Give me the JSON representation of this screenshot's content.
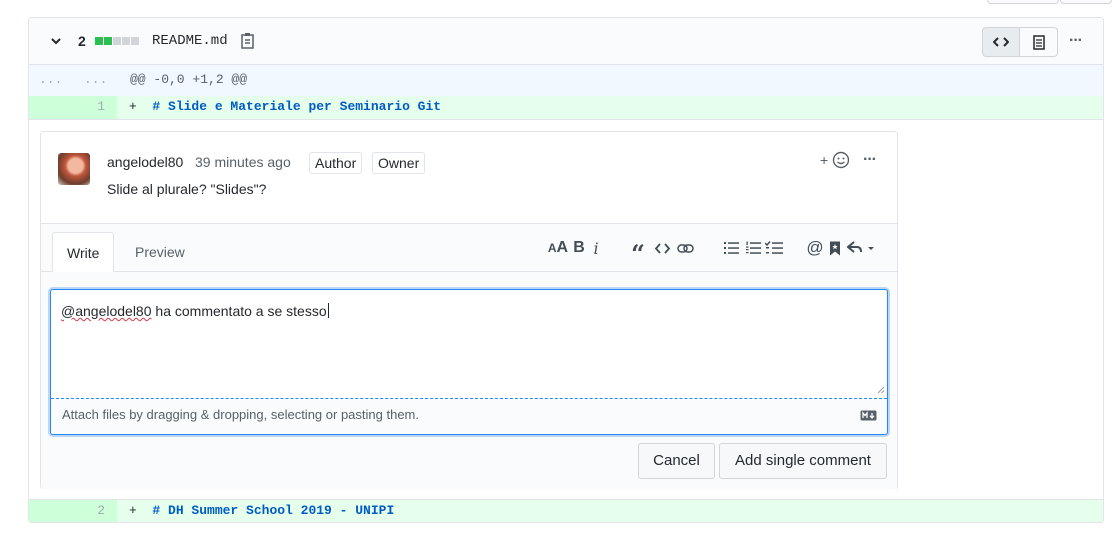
{
  "file": {
    "change_count": "2",
    "filename": "README.md",
    "diffstat_colors": [
      "#2cbe4e",
      "#2cbe4e",
      "#d1d5da",
      "#d1d5da",
      "#d1d5da"
    ]
  },
  "hunk": {
    "old_marker": "...",
    "new_marker": "...",
    "header": "@@ -0,0 +1,2 @@"
  },
  "lines": [
    {
      "num": "1",
      "sign": "+",
      "code": "# Slide e Materiale per Seminario Git"
    },
    {
      "num": "2",
      "sign": "+",
      "code": "# DH Summer School 2019 - UNIPI"
    }
  ],
  "comment": {
    "author": "angelodel80",
    "time": "39 minutes ago",
    "badges": [
      "Author",
      "Owner"
    ],
    "body": "Slide al plurale? \"Slides\"?",
    "react_label": "+"
  },
  "editor": {
    "tabs": [
      "Write",
      "Preview"
    ],
    "mention": "@angelodel80",
    "value_rest": " ha commentato a se stesso",
    "attach_hint": "Attach files by dragging & dropping, selecting or pasting them.",
    "cancel_label": "Cancel",
    "submit_label": "Add single comment",
    "toolbar_icons": [
      "header-icon",
      "bold-icon",
      "italic-icon",
      "quote-icon",
      "code-icon",
      "link-icon",
      "unordered-list-icon",
      "ordered-list-icon",
      "task-list-icon",
      "mention-icon",
      "saved-reply-icon",
      "reply-dropdown-icon"
    ]
  },
  "colors": {
    "addition_bg": "#e6ffed",
    "addition_gutter": "#cdffd8",
    "hunk_bg": "#f1f8ff",
    "focus_border": "#2188ff"
  }
}
